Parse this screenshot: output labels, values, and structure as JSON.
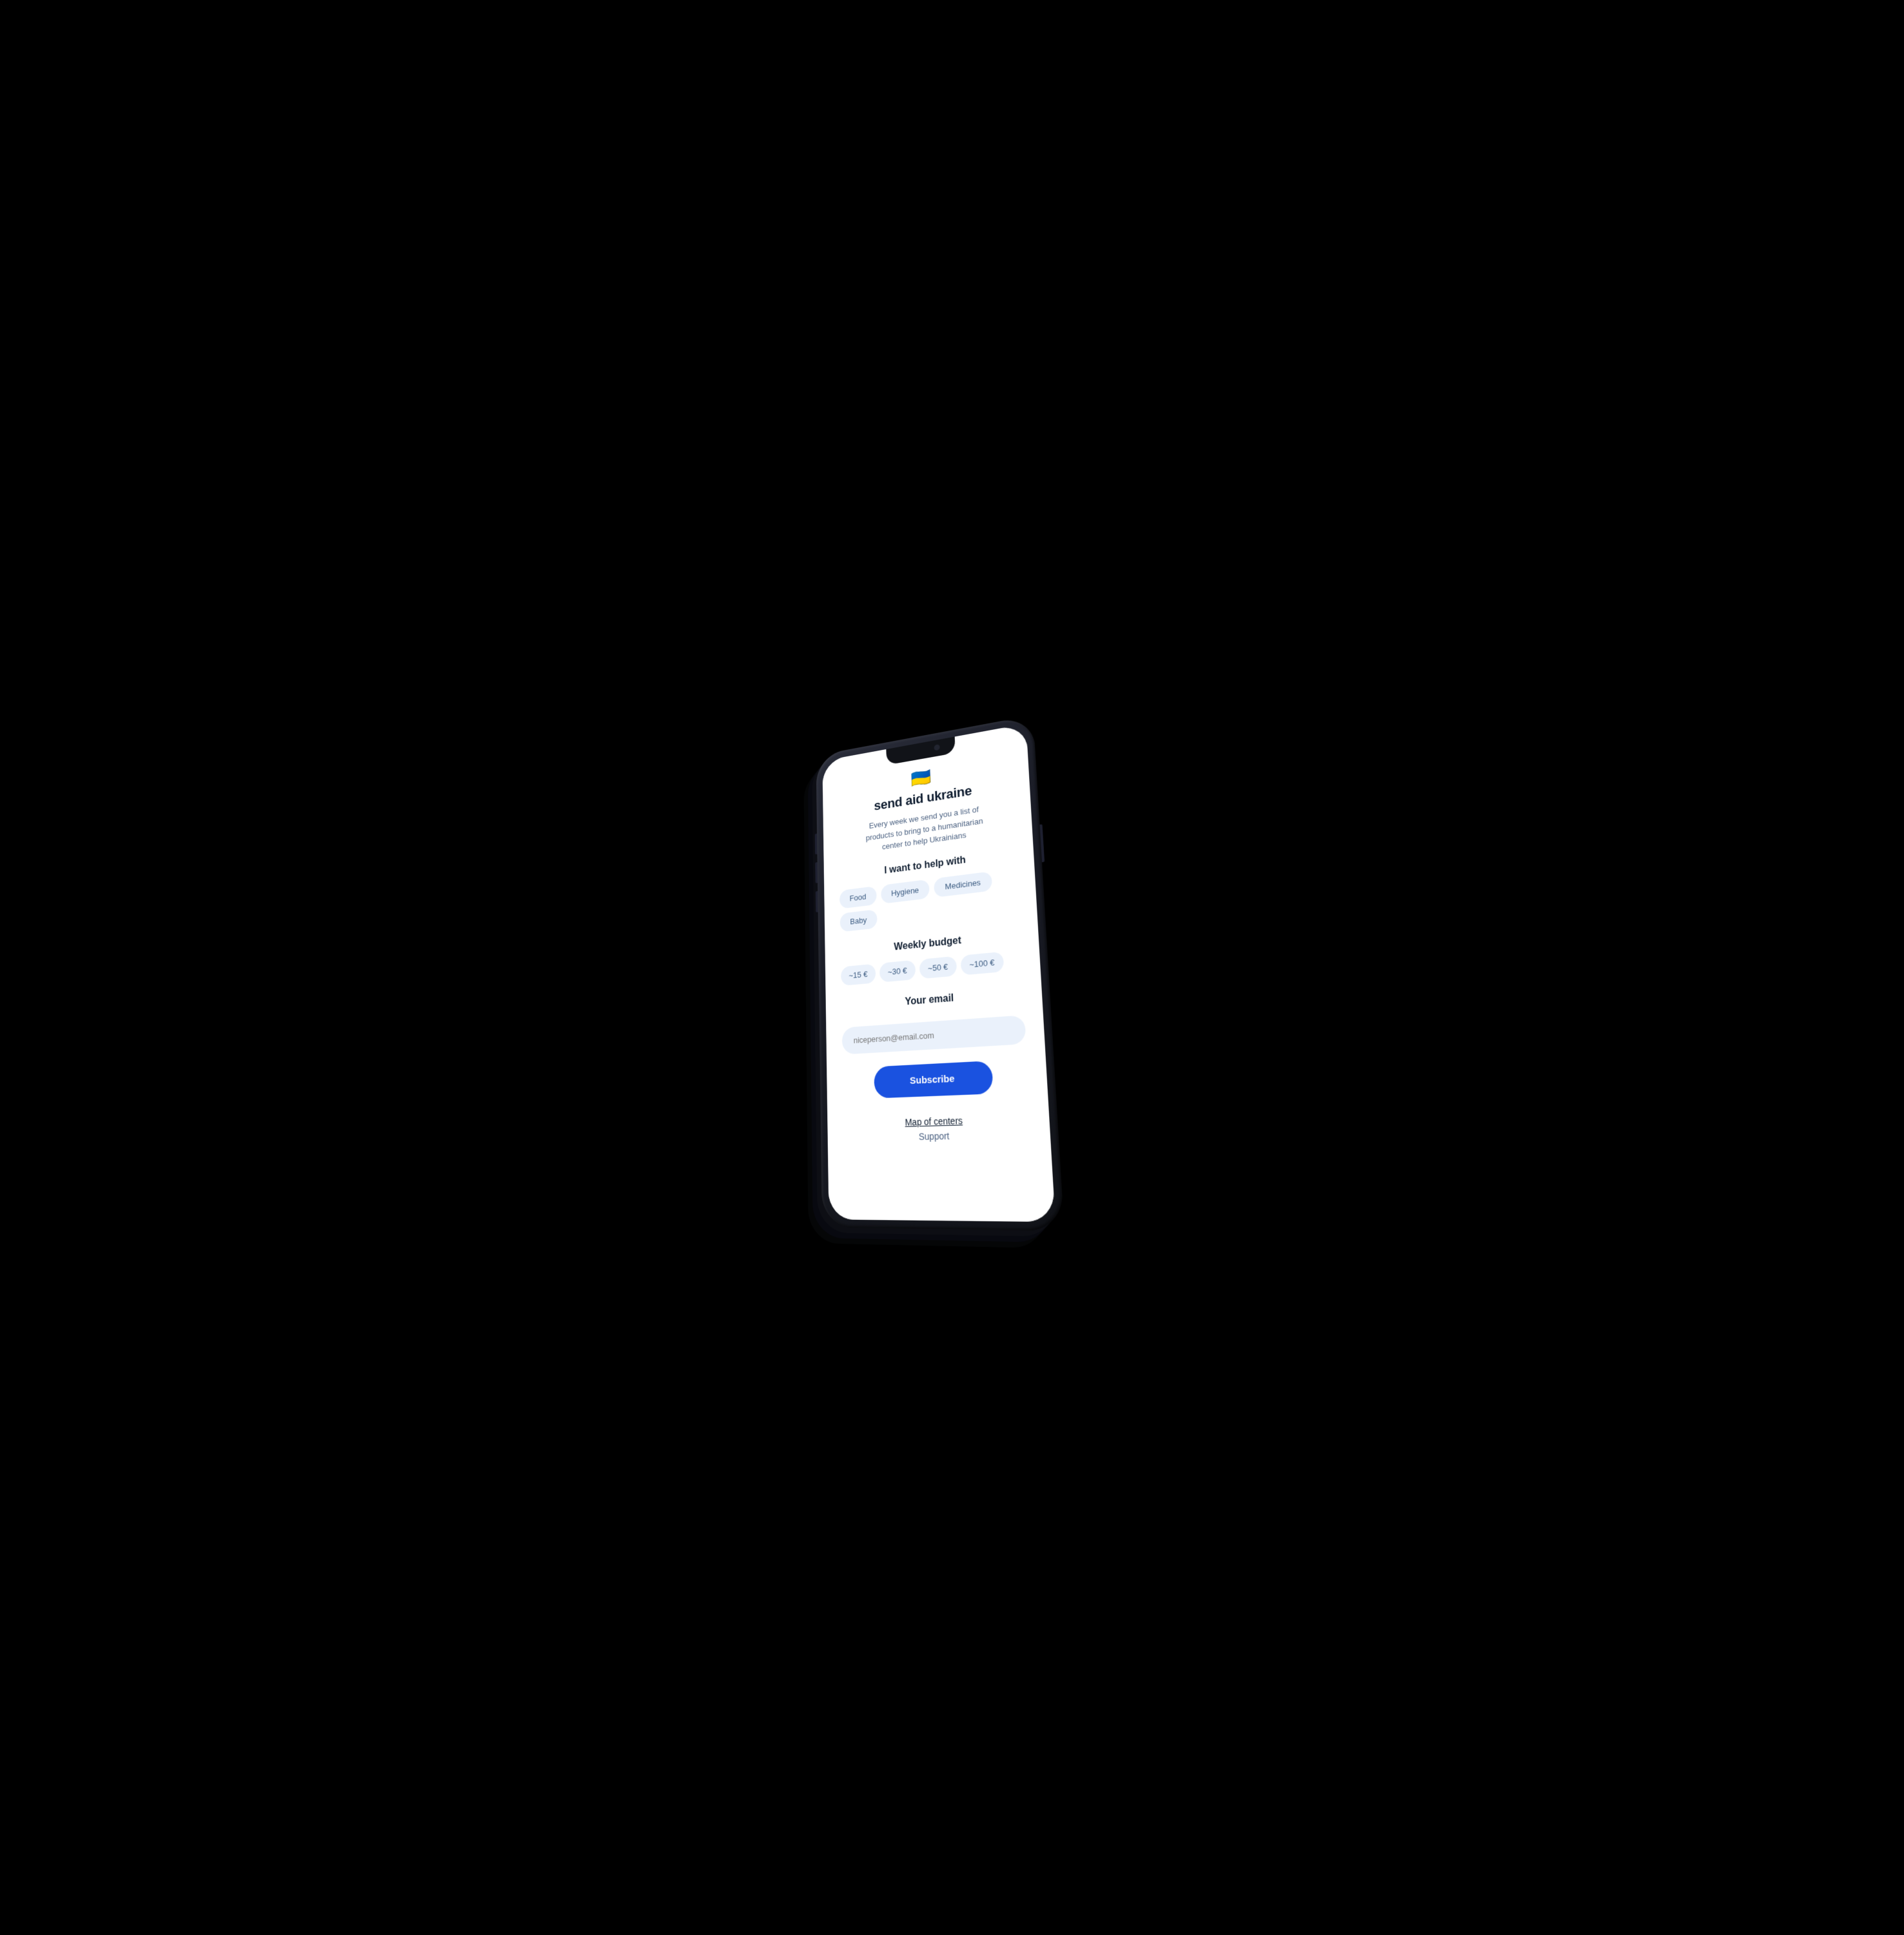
{
  "app": {
    "flag": "🇺🇦",
    "title": "send aid ukraine",
    "subtitle": "Every week we send you a list of products to bring to a humanitarian center to help Ukrainians"
  },
  "help_section": {
    "title": "I want to help with",
    "chips": [
      "Food",
      "Hygiene",
      "Medicines",
      "Baby"
    ]
  },
  "budget_section": {
    "title": "Weekly budget",
    "options": [
      "~15 €",
      "~30 €",
      "~50 €",
      "~100 €"
    ]
  },
  "email_section": {
    "title": "Your email",
    "placeholder": "niceperson@email.com"
  },
  "actions": {
    "subscribe": "Subscribe",
    "map_link": "Map of centers",
    "support_link": "Support"
  }
}
